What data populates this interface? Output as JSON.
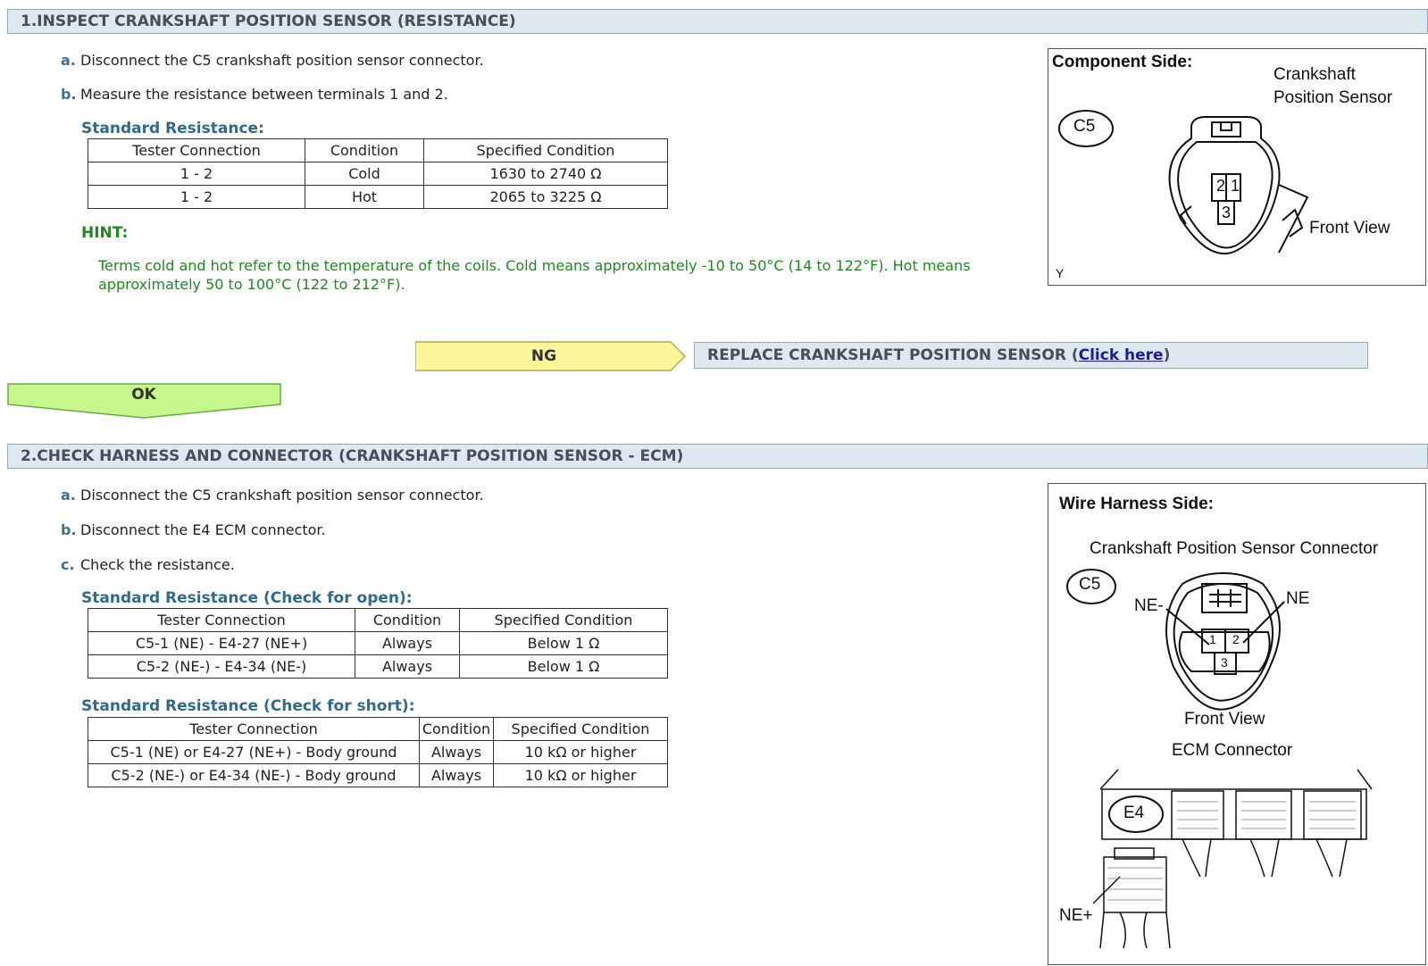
{
  "section1": {
    "header": "1.INSPECT CRANKSHAFT POSITION SENSOR (RESISTANCE)",
    "steps": [
      {
        "label": "a.",
        "text": "Disconnect the C5 crankshaft position sensor connector."
      },
      {
        "label": "b.",
        "text": "Measure the resistance between terminals 1 and 2."
      }
    ],
    "std_title": "Standard Resistance:",
    "table": {
      "headers": [
        "Tester Connection",
        "Condition",
        "Specified Condition"
      ],
      "rows": [
        [
          "1 - 2",
          "Cold",
          "1630 to 2740 Ω"
        ],
        [
          "1 - 2",
          "Hot",
          "2065 to 3225 Ω"
        ]
      ]
    },
    "hint_title": "HINT:",
    "hint_text": "Terms cold and hot refer to the temperature of the coils. Cold means approximately -10 to 50°C (14 to 122°F). Hot means approximately 50 to 100°C (122 to 212°F).",
    "figure": {
      "title": "Component Side:",
      "sensor_label_1": "Crankshaft",
      "sensor_label_2": "Position Sensor",
      "connector_id": "C5",
      "pin_1": "1",
      "pin_2": "2",
      "pin_3": "3",
      "view_label": "Front View",
      "corner_mark": "Y"
    }
  },
  "flow": {
    "ng_label": "NG",
    "replace_text": "REPLACE CRANKSHAFT POSITION SENSOR (",
    "link_text": "Click here",
    "replace_close": ")",
    "ok_label": "OK",
    "ng_color": "#fbf79a",
    "ok_color": "#c6f78a"
  },
  "section2": {
    "header": "2.CHECK HARNESS AND CONNECTOR (CRANKSHAFT POSITION SENSOR - ECM)",
    "steps": [
      {
        "label": "a.",
        "text": "Disconnect the C5 crankshaft position sensor connector."
      },
      {
        "label": "b.",
        "text": "Disconnect the E4 ECM connector."
      },
      {
        "label": "c.",
        "text": "Check the resistance."
      }
    ],
    "open_title": "Standard Resistance (Check for open):",
    "open_table": {
      "headers": [
        "Tester Connection",
        "Condition",
        "Specified Condition"
      ],
      "rows": [
        [
          "C5-1 (NE) - E4-27 (NE+)",
          "Always",
          "Below 1 Ω"
        ],
        [
          "C5-2 (NE-) - E4-34 (NE-)",
          "Always",
          "Below 1 Ω"
        ]
      ]
    },
    "short_title": "Standard Resistance (Check for short):",
    "short_table": {
      "headers": [
        "Tester Connection",
        "Condition",
        "Specified Condition"
      ],
      "rows": [
        [
          "C5-1 (NE) or E4-27 (NE+) - Body ground",
          "Always",
          "10 kΩ or higher"
        ],
        [
          "C5-2 (NE-) or E4-34 (NE-) - Body ground",
          "Always",
          "10 kΩ or higher"
        ]
      ]
    },
    "figure": {
      "title": "Wire Harness Side:",
      "sensor_connector_label": "Crankshaft Position Sensor Connector",
      "connector_id": "C5",
      "ne_minus": "NE-",
      "ne": "NE",
      "pin_1": "1",
      "pin_2": "2",
      "pin_3": "3",
      "view_label": "Front View",
      "ecm_label": "ECM Connector",
      "ecm_id": "E4",
      "ne_plus": "NE+"
    }
  }
}
